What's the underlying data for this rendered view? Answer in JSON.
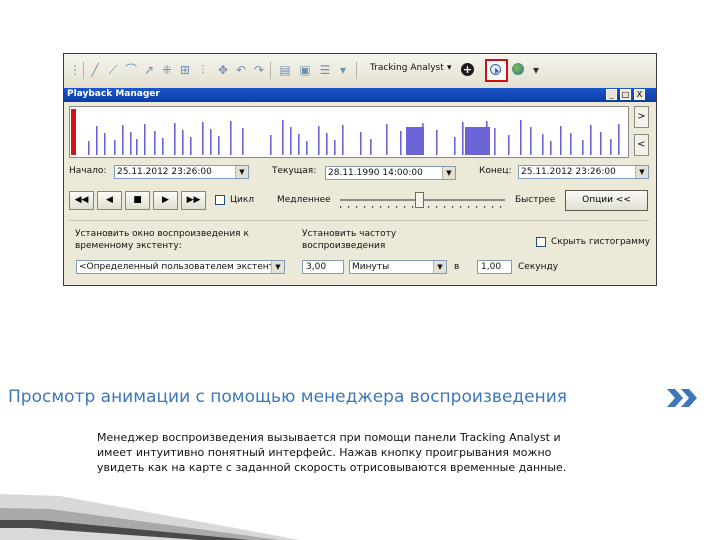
{
  "toolbar": {
    "app_label": "Tracking Analyst",
    "icons": [
      "select-icon",
      "line-icon",
      "polyline-icon",
      "curve-icon",
      "arrow-icon",
      "grid-icon",
      "align-icon",
      "distribute-icon",
      "move-icon",
      "rotate-icon",
      "redo-icon",
      "table-icon",
      "image-icon",
      "properties-icon",
      "plus-icon",
      "play-icon",
      "globe-icon"
    ]
  },
  "window": {
    "title": "Playback Manager",
    "buttons": [
      "_",
      "□",
      "X"
    ]
  },
  "controls": {
    "start_label": "Начало:",
    "start_value": "25.11.2012 23:26:00",
    "current_label": "Текущая:",
    "current_value": "28.11.1990 14:00:00",
    "end_label": "Конец:",
    "end_value": "25.11.2012 23:26:00",
    "playback_buttons": [
      "◀◀",
      "◀",
      "■",
      "▶",
      "▶▶"
    ],
    "loop_label": "Цикл",
    "slow_label": "Медленнее",
    "fast_label": "Быстрее",
    "slider_level": 0.48,
    "options_label": "Опции <<",
    "window_label_1": "Установить окно воспроизведения к",
    "window_label_2": "временному экстенту:",
    "window_value": "<Определенный пользователем экстент>",
    "rate_label_1": "Установить частоту",
    "rate_label_2": "воспроизведения",
    "rate_value": "3,00",
    "rate_unit": "Минуты",
    "in_label": "в",
    "seconds_value": "1,00",
    "seconds_label": "Секунду",
    "hide_histogram_label": "Скрыть гистограмму"
  },
  "slide": {
    "title": "Просмотр анимации с помощью менеджера воспроизведения",
    "body_lines": [
      "Менеджер воспроизведения вызывается при помощи панели Tracking Analyst и",
      "имеет интуитивно понятный интерфейс. Нажав кнопку проигрывания можно",
      "увидеть как на карте с заданной скорость отрисовываются временные данные."
    ]
  },
  "colors": {
    "title_bar": "#0a3da3",
    "histogram_bars": "#6b63d6",
    "cursor": "#d41414",
    "slide_title": "#3c78b8"
  }
}
